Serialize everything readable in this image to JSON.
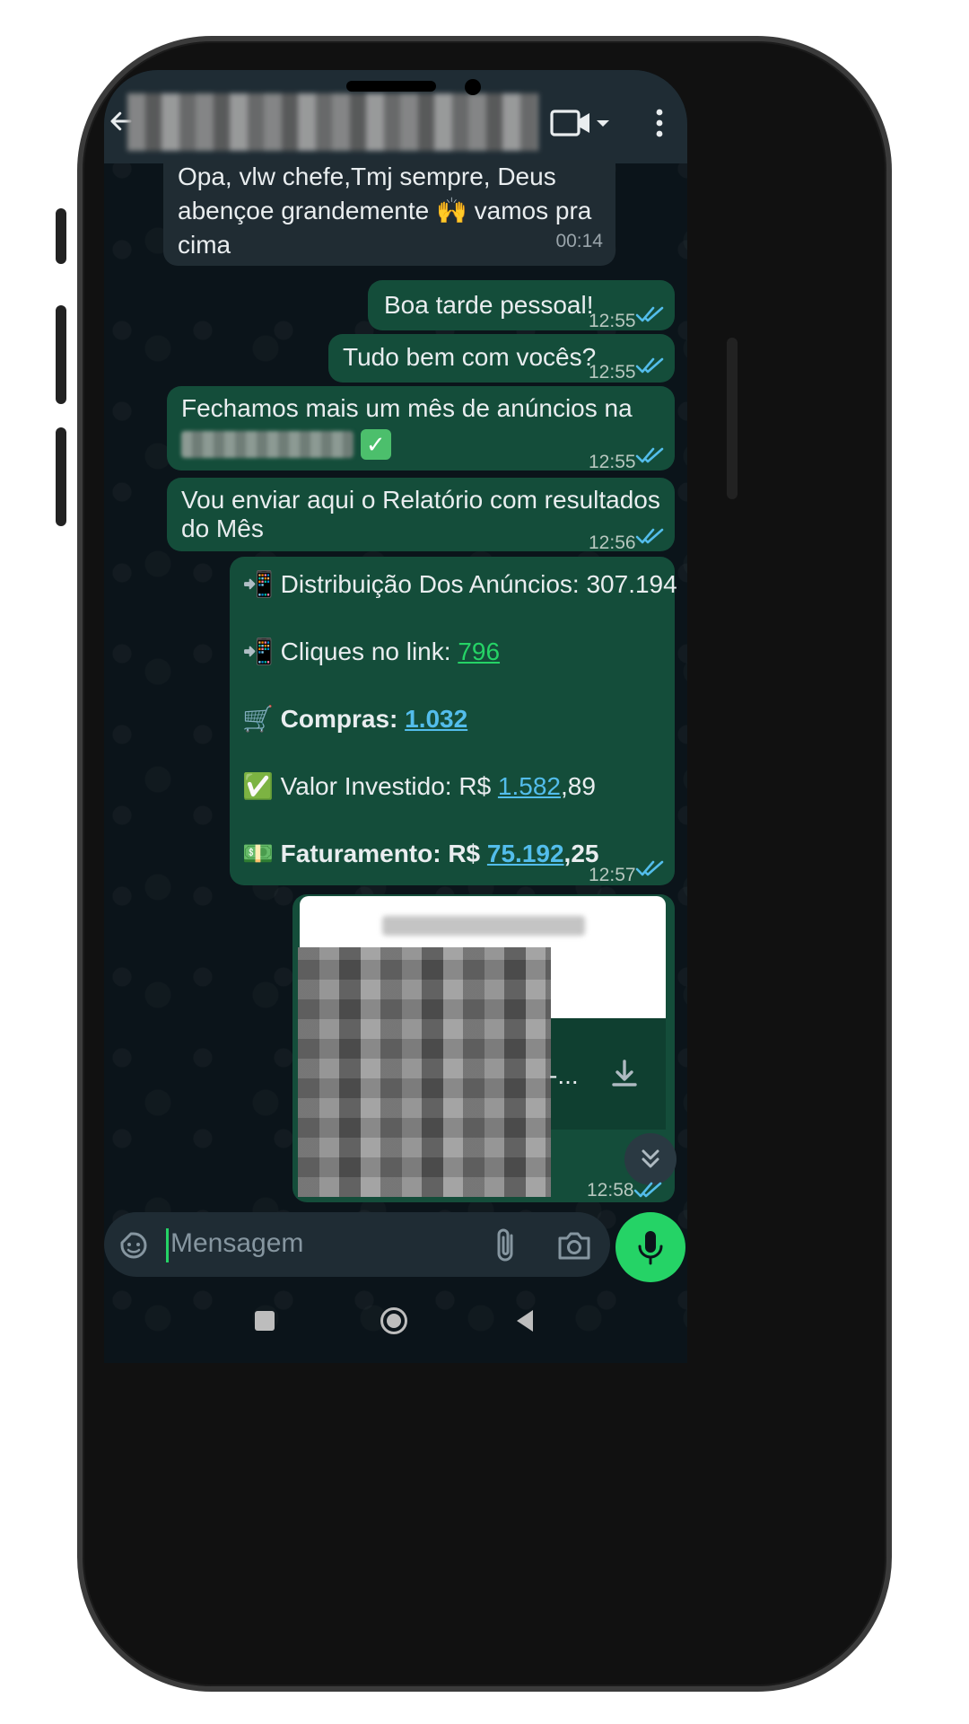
{
  "header": {
    "back_icon": "arrow-left-icon",
    "video_icon": "video-call-icon",
    "more_icon": "more-vert-icon"
  },
  "messages": [
    {
      "direction": "in",
      "text_lines": [
        "Opa, vlw chefe,Tmj sempre, Deus",
        "abençoe grandemente 🙌 vamos pra",
        "cima"
      ],
      "time": "00:14"
    },
    {
      "direction": "out",
      "text": "Boa tarde pessoal!",
      "time": "12:55"
    },
    {
      "direction": "out",
      "text": "Tudo bem com vocês?",
      "time": "12:55"
    },
    {
      "direction": "out",
      "text": "Fechamos mais um mês de anúncios na",
      "emoji_after_blur": "✅",
      "time": "12:55"
    },
    {
      "direction": "out",
      "text_lines": [
        "Vou enviar aqui o Relatório com resultados",
        "do Mês"
      ],
      "time": "12:56"
    },
    {
      "direction": "out",
      "report": {
        "line1_emoji": "📲",
        "line1_label": "Distribuição Dos Anúncios: 307.194",
        "line2_emoji": "📲",
        "line2_label": "Cliques no link: ",
        "line2_link": "796",
        "line3_emoji": "🛒",
        "line3_label": "Compras: ",
        "line3_link": "1.032",
        "line4_emoji": "✅",
        "line4_label": "Valor Investido: R$ ",
        "line4_link": "1.582",
        "line4_suffix": ",89",
        "line5_emoji": "💵",
        "line5_label": "Faturamento: R$ ",
        "line5_link": "75.192",
        "line5_suffix": ",25"
      },
      "time": "12:57"
    },
    {
      "direction": "out",
      "attachment": "document",
      "ellipsis": "-...",
      "time": "12:58"
    }
  ],
  "composer": {
    "placeholder": "Mensagem",
    "sticker_icon": "sticker-icon",
    "attach_icon": "paperclip-icon",
    "camera_icon": "camera-icon",
    "mic_icon": "microphone-icon"
  },
  "colors": {
    "outgoing_bubble": "#144d3a",
    "incoming_bubble": "#202c33",
    "accent": "#25d366",
    "read_ticks": "#53bdeb"
  }
}
